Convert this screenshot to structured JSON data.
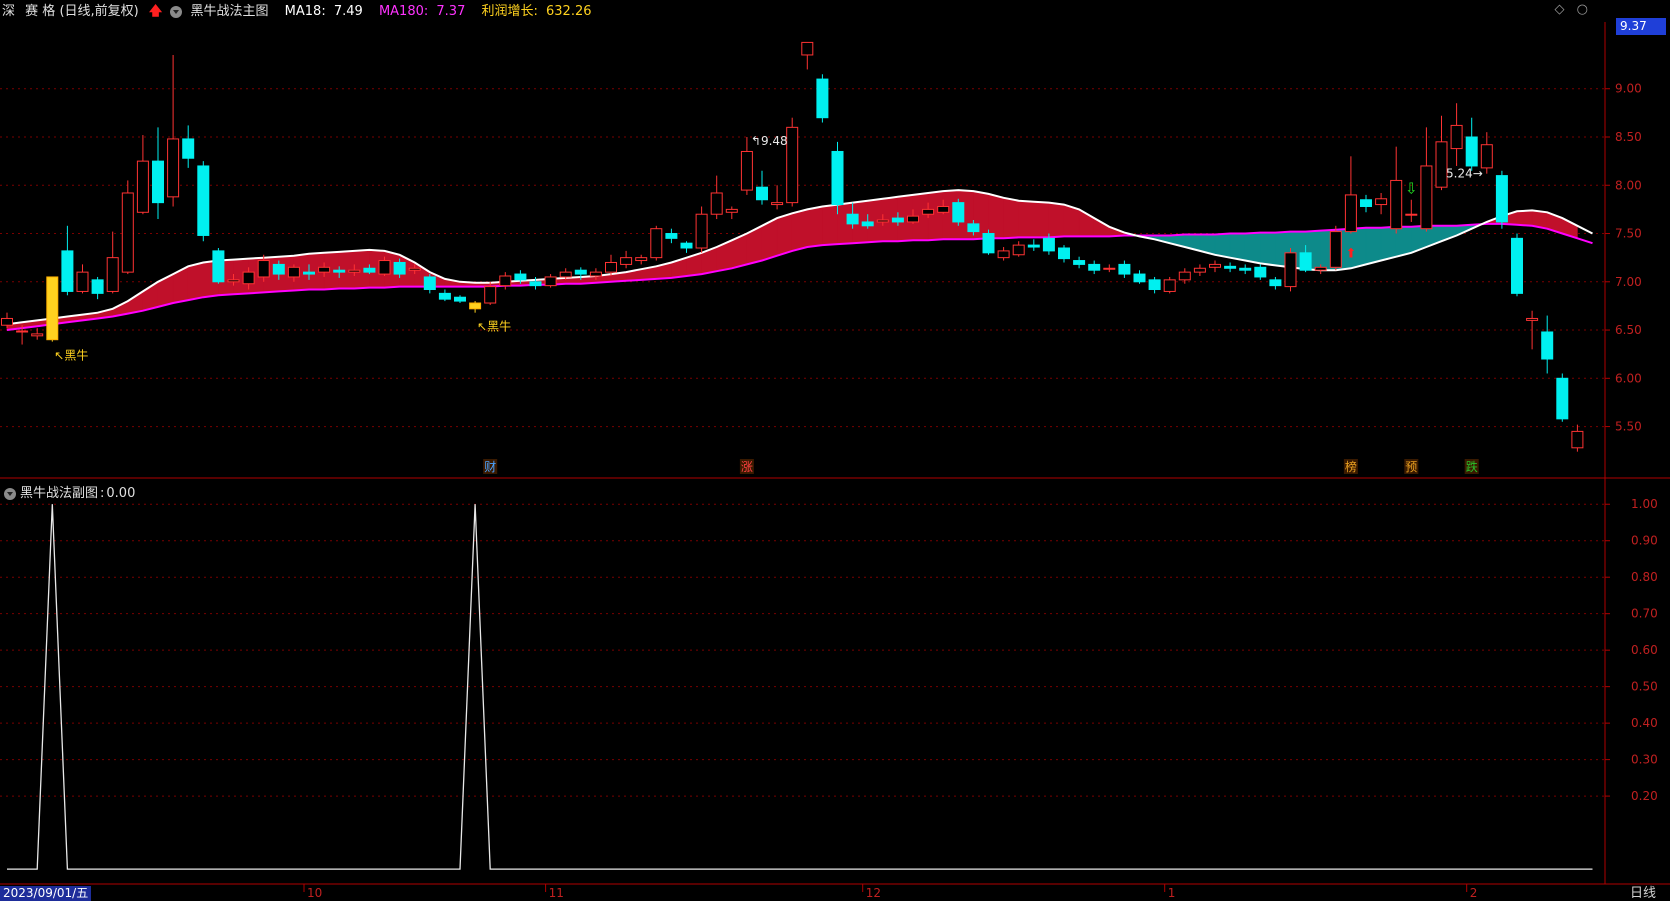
{
  "header": {
    "market": "深",
    "name": "赛 格",
    "mode": "(日线,前复权)",
    "indicator_name": "黑牛战法主图",
    "ma18_label": "MA18:",
    "ma18_value": "7.49",
    "ma180_label": "MA180:",
    "ma180_value": "7.37",
    "profit_label": "利润增长:",
    "profit_value": "632.26"
  },
  "top_right_icons": [
    "diamond-icon",
    "circle-icon"
  ],
  "current_price_tag": "9.37",
  "sub_header": {
    "indicator_name": "黑牛战法副图",
    "value_label": ":",
    "value": "0.00"
  },
  "footer": {
    "start_date": "2023/09/01/五",
    "period": "日线"
  },
  "colors": {
    "up": "#ff3333",
    "down": "#00f0f0",
    "ma18": "#ffffff",
    "ma180": "#ff00ff",
    "band_up": "#c0102a",
    "band_down": "#0d8a8a",
    "grid": "#7a0000",
    "signal": "#ffd21f"
  },
  "chart_data": {
    "type": "candlestick",
    "main_axis": {
      "ylim": [
        5.05,
        9.65
      ],
      "ticks": [
        "9.00",
        "8.50",
        "8.00",
        "7.50",
        "7.00",
        "6.50",
        "6.00",
        "5.50"
      ],
      "tick_values": [
        9.0,
        8.5,
        8.0,
        7.5,
        7.0,
        6.5,
        6.0,
        5.5
      ]
    },
    "x_labels": [
      {
        "label": "10",
        "bar": 20
      },
      {
        "label": "11",
        "bar": 36
      },
      {
        "label": "12",
        "bar": 57
      },
      {
        "label": "1",
        "bar": 77
      },
      {
        "label": "2",
        "bar": 97
      }
    ],
    "annotations": {
      "high_label": "9.48",
      "high_bar": 49,
      "low_label": "5.24",
      "low_bar": 98,
      "signals": [
        {
          "label": "黑牛",
          "bar": 3
        },
        {
          "label": "黑牛",
          "bar": 31
        }
      ],
      "events": [
        {
          "label": "财",
          "bar": 32,
          "color": "#4aa3ff"
        },
        {
          "label": "涨",
          "bar": 49,
          "color": "#ff4040"
        },
        {
          "label": "榜",
          "bar": 89,
          "color": "#e8a020"
        },
        {
          "label": "预",
          "bar": 93,
          "color": "#e8a020"
        },
        {
          "label": "跌",
          "bar": 97,
          "color": "#29c229"
        }
      ],
      "up_arrow_bar": 89,
      "down_arrow_bar": 93
    },
    "candles": [
      [
        6.55,
        6.62,
        6.68,
        6.52
      ],
      [
        6.48,
        6.49,
        6.55,
        6.35
      ],
      [
        6.44,
        6.46,
        6.52,
        6.4
      ],
      [
        6.4,
        7.05,
        7.05,
        6.38
      ],
      [
        7.32,
        6.9,
        7.58,
        6.86
      ],
      [
        6.9,
        7.1,
        7.18,
        6.88
      ],
      [
        7.02,
        6.88,
        7.05,
        6.82
      ],
      [
        6.9,
        7.25,
        7.52,
        6.88
      ],
      [
        7.1,
        7.92,
        8.05,
        7.08
      ],
      [
        7.72,
        8.25,
        8.52,
        7.7
      ],
      [
        8.25,
        7.82,
        8.6,
        7.65
      ],
      [
        7.88,
        8.48,
        9.35,
        7.78
      ],
      [
        8.48,
        8.28,
        8.62,
        8.18
      ],
      [
        8.2,
        7.48,
        8.25,
        7.42
      ],
      [
        7.32,
        7.0,
        7.35,
        6.98
      ],
      [
        7.0,
        7.02,
        7.08,
        6.96
      ],
      [
        6.98,
        7.1,
        7.15,
        6.92
      ],
      [
        7.05,
        7.22,
        7.28,
        7.0
      ],
      [
        7.18,
        7.08,
        7.22,
        7.02
      ],
      [
        7.05,
        7.15,
        7.18,
        7.0
      ],
      [
        7.1,
        7.08,
        7.18,
        7.02
      ],
      [
        7.1,
        7.15,
        7.2,
        7.05
      ],
      [
        7.12,
        7.1,
        7.16,
        7.04
      ],
      [
        7.1,
        7.12,
        7.18,
        7.06
      ],
      [
        7.14,
        7.1,
        7.18,
        7.08
      ],
      [
        7.08,
        7.22,
        7.26,
        7.06
      ],
      [
        7.2,
        7.08,
        7.24,
        7.04
      ],
      [
        7.12,
        7.14,
        7.18,
        7.08
      ],
      [
        7.05,
        6.92,
        7.08,
        6.88
      ],
      [
        6.88,
        6.82,
        6.92,
        6.8
      ],
      [
        6.84,
        6.8,
        6.86,
        6.78
      ],
      [
        6.78,
        6.72,
        6.8,
        6.68
      ],
      [
        6.78,
        6.95,
        7.0,
        6.76
      ],
      [
        6.96,
        7.06,
        7.1,
        6.92
      ],
      [
        7.08,
        7.02,
        7.12,
        6.98
      ],
      [
        7.0,
        6.96,
        7.05,
        6.92
      ],
      [
        6.96,
        7.05,
        7.08,
        6.94
      ],
      [
        7.05,
        7.1,
        7.14,
        7.02
      ],
      [
        7.12,
        7.08,
        7.15,
        7.02
      ],
      [
        7.06,
        7.1,
        7.14,
        7.02
      ],
      [
        7.1,
        7.2,
        7.28,
        7.06
      ],
      [
        7.18,
        7.25,
        7.32,
        7.14
      ],
      [
        7.22,
        7.25,
        7.28,
        7.18
      ],
      [
        7.25,
        7.55,
        7.58,
        7.22
      ],
      [
        7.5,
        7.45,
        7.55,
        7.4
      ],
      [
        7.4,
        7.35,
        7.42,
        7.3
      ],
      [
        7.35,
        7.7,
        7.78,
        7.3
      ],
      [
        7.7,
        7.92,
        8.1,
        7.65
      ],
      [
        7.72,
        7.75,
        7.78,
        7.65
      ],
      [
        7.95,
        8.35,
        8.5,
        7.9
      ],
      [
        7.98,
        7.85,
        8.15,
        7.8
      ],
      [
        7.8,
        7.82,
        8.0,
        7.75
      ],
      [
        7.82,
        8.6,
        8.7,
        7.78
      ],
      [
        9.35,
        9.48,
        9.48,
        9.2
      ],
      [
        9.1,
        8.7,
        9.15,
        8.65
      ],
      [
        8.35,
        7.8,
        8.45,
        7.7
      ],
      [
        7.7,
        7.6,
        7.82,
        7.55
      ],
      [
        7.62,
        7.58,
        7.7,
        7.55
      ],
      [
        7.62,
        7.64,
        7.7,
        7.58
      ],
      [
        7.66,
        7.62,
        7.72,
        7.58
      ],
      [
        7.62,
        7.68,
        7.75,
        7.6
      ],
      [
        7.7,
        7.75,
        7.82,
        7.66
      ],
      [
        7.72,
        7.78,
        7.85,
        7.7
      ],
      [
        7.82,
        7.62,
        7.86,
        7.58
      ],
      [
        7.6,
        7.52,
        7.64,
        7.48
      ],
      [
        7.5,
        7.3,
        7.54,
        7.28
      ],
      [
        7.25,
        7.32,
        7.36,
        7.22
      ],
      [
        7.28,
        7.38,
        7.42,
        7.26
      ],
      [
        7.38,
        7.36,
        7.44,
        7.32
      ],
      [
        7.45,
        7.32,
        7.5,
        7.28
      ],
      [
        7.35,
        7.24,
        7.38,
        7.2
      ],
      [
        7.22,
        7.18,
        7.26,
        7.14
      ],
      [
        7.18,
        7.12,
        7.22,
        7.08
      ],
      [
        7.14,
        7.14,
        7.18,
        7.1
      ],
      [
        7.18,
        7.08,
        7.22,
        7.04
      ],
      [
        7.08,
        7.0,
        7.12,
        6.98
      ],
      [
        7.02,
        6.92,
        7.05,
        6.88
      ],
      [
        6.9,
        7.02,
        7.05,
        6.88
      ],
      [
        7.02,
        7.1,
        7.14,
        6.98
      ],
      [
        7.1,
        7.14,
        7.18,
        7.06
      ],
      [
        7.15,
        7.18,
        7.22,
        7.1
      ],
      [
        7.16,
        7.14,
        7.2,
        7.1
      ],
      [
        7.14,
        7.12,
        7.18,
        7.08
      ],
      [
        7.15,
        7.05,
        7.18,
        7.02
      ],
      [
        7.02,
        6.96,
        7.05,
        6.92
      ],
      [
        6.95,
        7.3,
        7.35,
        6.9
      ],
      [
        7.3,
        7.12,
        7.38,
        7.1
      ],
      [
        7.12,
        7.15,
        7.18,
        7.08
      ],
      [
        7.15,
        7.52,
        7.58,
        7.12
      ],
      [
        7.52,
        7.9,
        8.3,
        7.5
      ],
      [
        7.85,
        7.78,
        7.9,
        7.72
      ],
      [
        7.8,
        7.86,
        7.92,
        7.7
      ],
      [
        7.55,
        8.05,
        8.4,
        7.5
      ],
      [
        7.7,
        7.7,
        7.85,
        7.62
      ],
      [
        7.55,
        8.2,
        8.6,
        7.52
      ],
      [
        7.98,
        8.45,
        8.72,
        7.95
      ],
      [
        8.38,
        8.62,
        8.85,
        8.2
      ],
      [
        8.5,
        8.2,
        8.7,
        8.15
      ],
      [
        8.18,
        8.42,
        8.55,
        8.12
      ],
      [
        8.1,
        7.62,
        8.15,
        7.55
      ],
      [
        7.45,
        6.88,
        7.5,
        6.85
      ],
      [
        6.6,
        6.62,
        6.7,
        6.3
      ],
      [
        6.48,
        6.2,
        6.65,
        6.05
      ],
      [
        6.0,
        5.58,
        6.05,
        5.55
      ],
      [
        5.28,
        5.45,
        5.52,
        5.24
      ]
    ],
    "ma18": [
      6.56,
      6.58,
      6.6,
      6.62,
      6.64,
      6.66,
      6.68,
      6.72,
      6.8,
      6.9,
      7.0,
      7.08,
      7.16,
      7.2,
      7.22,
      7.23,
      7.24,
      7.25,
      7.26,
      7.27,
      7.29,
      7.3,
      7.31,
      7.32,
      7.33,
      7.32,
      7.28,
      7.2,
      7.1,
      7.03,
      7.0,
      6.99,
      6.99,
      7.0,
      7.01,
      7.02,
      7.03,
      7.04,
      7.05,
      7.06,
      7.08,
      7.1,
      7.13,
      7.16,
      7.2,
      7.25,
      7.3,
      7.36,
      7.43,
      7.5,
      7.58,
      7.66,
      7.71,
      7.75,
      7.78,
      7.8,
      7.82,
      7.84,
      7.86,
      7.88,
      7.9,
      7.92,
      7.94,
      7.95,
      7.94,
      7.91,
      7.87,
      7.84,
      7.83,
      7.82,
      7.8,
      7.75,
      7.66,
      7.57,
      7.51,
      7.47,
      7.44,
      7.4,
      7.36,
      7.32,
      7.28,
      7.25,
      7.22,
      7.19,
      7.17,
      7.15,
      7.13,
      7.12,
      7.12,
      7.14,
      7.18,
      7.22,
      7.26,
      7.3,
      7.36,
      7.42,
      7.48,
      7.55,
      7.62,
      7.68,
      7.73,
      7.74,
      7.72,
      7.66,
      7.58,
      7.5
    ],
    "ma180": [
      6.5,
      6.52,
      6.54,
      6.56,
      6.58,
      6.6,
      6.62,
      6.64,
      6.67,
      6.7,
      6.74,
      6.78,
      6.81,
      6.84,
      6.86,
      6.87,
      6.88,
      6.89,
      6.9,
      6.91,
      6.92,
      6.92,
      6.93,
      6.93,
      6.94,
      6.94,
      6.95,
      6.95,
      6.95,
      6.95,
      6.95,
      6.95,
      6.95,
      6.96,
      6.96,
      6.97,
      6.97,
      6.98,
      6.98,
      6.99,
      7.0,
      7.01,
      7.02,
      7.03,
      7.04,
      7.06,
      7.08,
      7.11,
      7.14,
      7.18,
      7.22,
      7.27,
      7.32,
      7.36,
      7.38,
      7.39,
      7.4,
      7.41,
      7.42,
      7.42,
      7.43,
      7.43,
      7.44,
      7.44,
      7.44,
      7.45,
      7.45,
      7.46,
      7.46,
      7.46,
      7.47,
      7.47,
      7.47,
      7.47,
      7.48,
      7.48,
      7.48,
      7.48,
      7.49,
      7.49,
      7.49,
      7.5,
      7.5,
      7.51,
      7.51,
      7.52,
      7.52,
      7.53,
      7.54,
      7.55,
      7.56,
      7.56,
      7.57,
      7.57,
      7.58,
      7.58,
      7.58,
      7.59,
      7.6,
      7.6,
      7.59,
      7.58,
      7.55,
      7.5,
      7.45,
      7.4
    ],
    "sub_axis": {
      "ylim": [
        -0.03,
        1.05
      ],
      "ticks": [
        "1.00",
        "0.90",
        "0.80",
        "0.70",
        "0.60",
        "0.50",
        "0.40",
        "0.30",
        "0.20"
      ],
      "tick_values": [
        1.0,
        0.9,
        0.8,
        0.7,
        0.6,
        0.5,
        0.4,
        0.3,
        0.2
      ]
    },
    "signal_values": [
      0,
      0,
      0,
      1,
      0,
      0,
      0,
      0,
      0,
      0,
      0,
      0,
      0,
      0,
      0,
      0,
      0,
      0,
      0,
      0,
      0,
      0,
      0,
      0,
      0,
      0,
      0,
      0,
      0,
      0,
      0,
      1,
      0,
      0,
      0,
      0,
      0,
      0,
      0,
      0,
      0,
      0,
      0,
      0,
      0,
      0,
      0,
      0,
      0,
      0,
      0,
      0,
      0,
      0,
      0,
      0,
      0,
      0,
      0,
      0,
      0,
      0,
      0,
      0,
      0,
      0,
      0,
      0,
      0,
      0,
      0,
      0,
      0,
      0,
      0,
      0,
      0,
      0,
      0,
      0,
      0,
      0,
      0,
      0,
      0,
      0,
      0,
      0,
      0,
      0,
      0,
      0,
      0,
      0,
      0,
      0,
      0,
      0,
      0,
      0,
      0,
      0,
      0,
      0,
      0,
      0
    ]
  }
}
